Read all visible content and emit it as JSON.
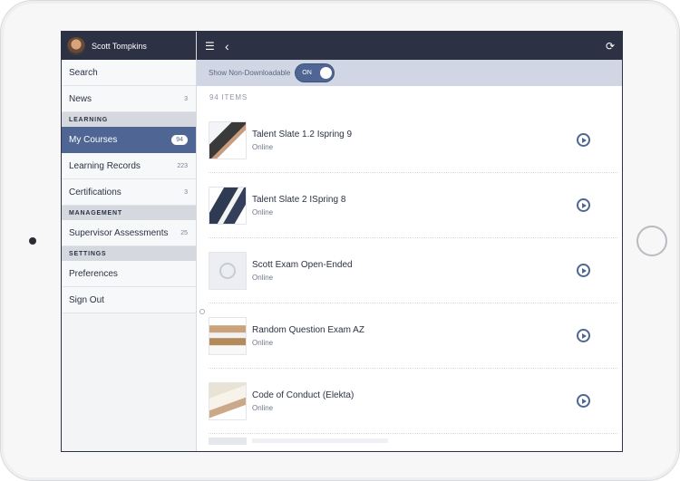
{
  "sidebar": {
    "user_name": "Scott Tompkins",
    "items": {
      "search": {
        "label": "Search"
      },
      "news": {
        "label": "News",
        "count": "3"
      },
      "learning_section": "LEARNING",
      "my_courses": {
        "label": "My Courses",
        "count": "94"
      },
      "learning_records": {
        "label": "Learning Records",
        "count": "223"
      },
      "certifications": {
        "label": "Certifications",
        "count": "3"
      },
      "management_section": "MANAGEMENT",
      "supervisor_assessments": {
        "label": "Supervisor Assessments",
        "count": "25"
      },
      "settings_section": "SETTINGS",
      "preferences": {
        "label": "Preferences"
      },
      "sign_out": {
        "label": "Sign Out"
      }
    }
  },
  "topbar": {
    "menu_icon": "hamburger-menu-icon",
    "back_icon": "chevron-left-icon",
    "refresh_icon": "refresh-icon"
  },
  "filter": {
    "label": "Show Non-Downloadable",
    "toggle_state": "ON"
  },
  "items_count_label": "94 ITEMS",
  "courses": [
    {
      "title": "Talent Slate 1.2 Ispring 9",
      "type": "Online"
    },
    {
      "title": "Talent Slate 2 ISpring 8",
      "type": "Online"
    },
    {
      "title": "Scott Exam Open-Ended",
      "type": "Online"
    },
    {
      "title": "Random Question Exam AZ",
      "type": "Online"
    },
    {
      "title": "Code of Conduct (Elekta)",
      "type": "Online"
    }
  ],
  "colors": {
    "header_dark": "#2c3244",
    "accent": "#4f6694",
    "filter_bar": "#d0d6e3"
  }
}
